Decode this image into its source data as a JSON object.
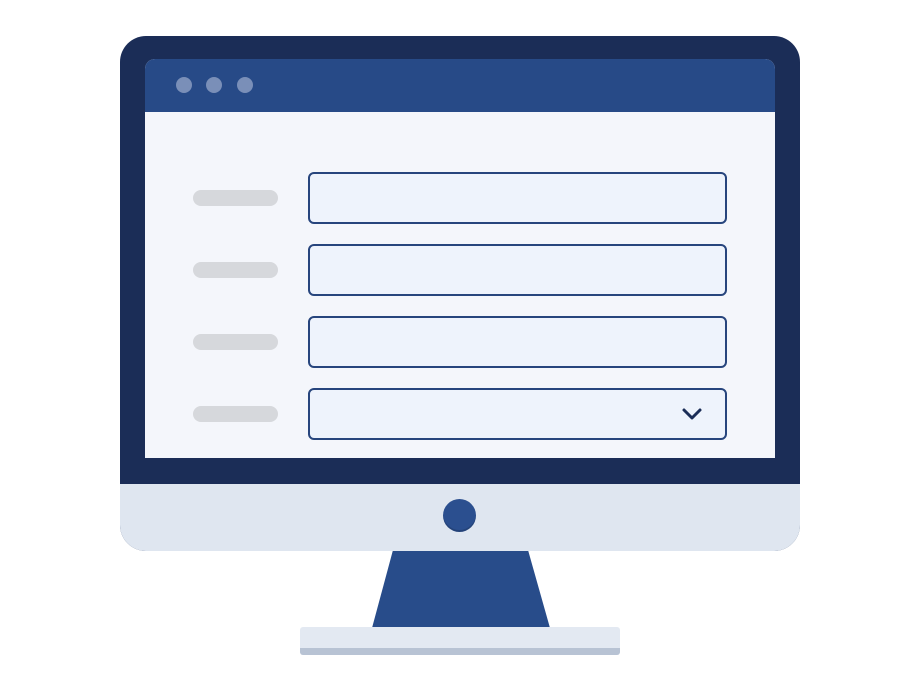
{
  "window": {
    "controls": [
      "window-dot",
      "window-dot",
      "window-dot"
    ]
  },
  "form": {
    "rows": [
      {
        "type": "text-field"
      },
      {
        "type": "text-field"
      },
      {
        "type": "text-field"
      },
      {
        "type": "dropdown",
        "icon": "chevron-down-icon"
      }
    ]
  },
  "colors": {
    "bezel": "#1b2d57",
    "titlebar": "#274a87",
    "field_border": "#27457d",
    "field_fill": "#eef3fc",
    "label_placeholder": "#d6d8dc",
    "chin": "#dfe6f0",
    "stand": "#284c8a"
  }
}
